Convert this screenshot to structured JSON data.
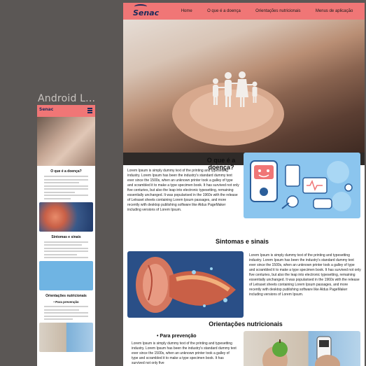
{
  "canvas": {
    "frame_label": "Android L..."
  },
  "mobile": {
    "logo": "Senac",
    "section1_title": "O que é a doença?",
    "section2_title": "Sintomas e sinais",
    "section3_title": "Orientações nutricionais",
    "bullet": "• Para prevenção"
  },
  "desktop": {
    "logo": "Senac",
    "nav": {
      "home": "Home",
      "disease": "O que é a doença",
      "nutrition": "Orientações nutricionais",
      "app": "Menus de aplicação"
    },
    "sections": {
      "disease": {
        "title": "O que é a doença?",
        "text": "Lorem Ipsum is simply dummy text of the printing and typesetting industry. Lorem Ipsum has been the industry's standard dummy text ever since the 1500s, when an unknown printer took a galley of type and scrambled it to make a type specimen book. It has survived not only five centuries, but also the leap into electronic typesetting, remaining essentially unchanged. It was popularised in the 1960s with the release of Letraset sheets containing Lorem Ipsum passages, and more recently with desktop publishing software like Aldus PageMaker including versions of Lorem Ipsum."
      },
      "symptoms": {
        "title": "Sintomas e sinais",
        "text": "Lorem Ipsum is simply dummy text of the printing and typesetting industry. Lorem Ipsum has been the industry's standard dummy text ever since the 1500s, when an unknown printer took a galley of type and scrambled it to make a type specimen book. It has survived not only five centuries, but also the leap into electronic typesetting, remaining essentially unchanged. It was popularised in the 1960s with the release of Letraset sheets containing Lorem Ipsum passages, and more recently with desktop publishing software like Aldus PageMaker including versions of Lorem Ipsum."
      },
      "nutrition": {
        "title": "Orientações nutricionais",
        "subtitle": "• Para prevenção",
        "text": "Lorem Ipsum is simply dummy text of the printing and typesetting industry. Lorem Ipsum has been the industry's standard dummy text ever since the 1500s, when an unknown printer took a galley of type and scrambled it to make a type specimen book. It has survived not only five"
      }
    }
  },
  "colors": {
    "nav": "#f07676",
    "logo": "#1a2a5a",
    "canvas": "#5b5755",
    "illustration_blue": "#8bc5ee"
  }
}
